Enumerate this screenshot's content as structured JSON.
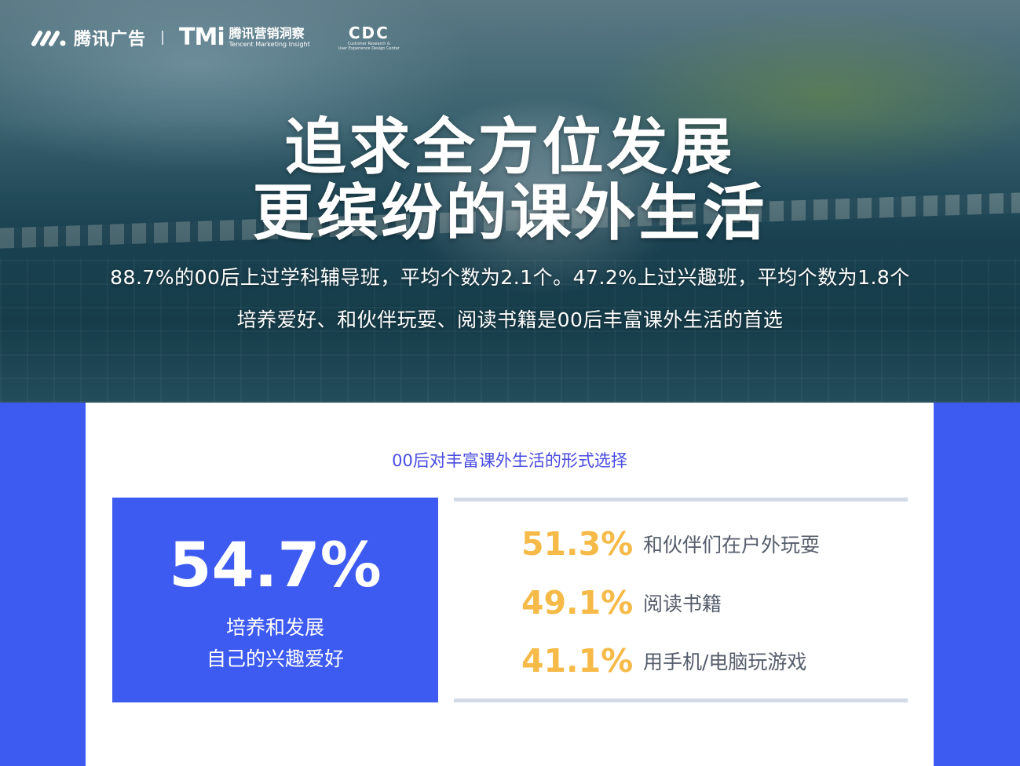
{
  "header": {
    "logos": {
      "tencent_ads": "腾讯广告",
      "tmi_mark": "TMi",
      "tmi_cn": "腾讯营销洞察",
      "tmi_en": "Tencent Marketing Insight",
      "cdc_mark": "CDC",
      "cdc_en_line1": "Customer Research &",
      "cdc_en_line2": "User Experience Design Center"
    }
  },
  "hero": {
    "title_line1": "追求全方位发展",
    "title_line2": "更缤纷的课外生活",
    "subtitle_line1": "88.7%的00后上过学科辅导班，平均个数为2.1个。47.2%上过兴趣班，平均个数为1.8个",
    "subtitle_line2": "培养爱好、和伙伴玩耍、阅读书籍是00后丰富课外生活的首选"
  },
  "card": {
    "title": "00后对丰富课外生活的形式选择",
    "highlight": {
      "value": "54.7%",
      "label_line1": "培养和发展",
      "label_line2": "自己的兴趣爱好"
    },
    "items": [
      {
        "value": "51.3%",
        "label": "和伙伴们在户外玩耍"
      },
      {
        "value": "49.1%",
        "label": "阅读书籍"
      },
      {
        "value": "41.1%",
        "label": "用手机/电脑玩游戏"
      }
    ]
  },
  "colors": {
    "brand_blue": "#3d5af1",
    "title_purple": "#4a4be0",
    "accent_orange": "#f6ba48",
    "divider": "#d2dae8"
  }
}
